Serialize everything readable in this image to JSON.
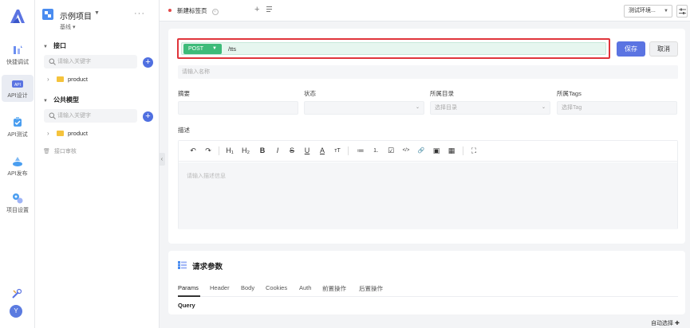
{
  "rail": {
    "items": [
      {
        "label": "快捷调试",
        "icon": "quick-debug-icon"
      },
      {
        "label": "API设计",
        "icon": "api-design-icon",
        "active": true
      },
      {
        "label": "API测试",
        "icon": "api-test-icon"
      },
      {
        "label": "API发布",
        "icon": "api-publish-icon"
      },
      {
        "label": "项目设置",
        "icon": "project-settings-icon"
      }
    ],
    "avatar_letter": "Y"
  },
  "sidebar": {
    "project_name": "示例项目",
    "branch": "基线",
    "more": "···",
    "interface_section": "接口",
    "interface_search_placeholder": "请输入关键字",
    "interface_tree": [
      {
        "label": "product"
      }
    ],
    "model_section": "公共模型",
    "model_search_placeholder": "请输入关键字",
    "model_tree": [
      {
        "label": "product"
      }
    ],
    "recycle_bin": "接口审核"
  },
  "tabs": {
    "active_tab": "新建标签页",
    "environment": "测试环境..."
  },
  "editor": {
    "method": "POST",
    "url": "/tts",
    "save_label": "保存",
    "cancel_label": "取消",
    "name_placeholder": "请输入名称",
    "summary_label": "摘要",
    "status_label": "状态",
    "directory_label": "所属目录",
    "directory_placeholder": "选择目录",
    "tags_label": "所属Tags",
    "tags_placeholder": "选择Tag",
    "description_label": "描述",
    "description_placeholder": "请输入描述信息",
    "toolbar": [
      "↶",
      "↷",
      "H₁",
      "H₂",
      "B",
      "I",
      "S",
      "U",
      "A",
      "ᴛT",
      "≔",
      "⒈",
      "☑",
      "</>",
      "🔗",
      "▣",
      "▦",
      "⛶"
    ]
  },
  "params": {
    "title": "请求参数",
    "tabs": [
      "Params",
      "Header",
      "Body",
      "Cookies",
      "Auth",
      "前置操作",
      "后置操作"
    ],
    "query_label": "Query"
  },
  "footer": {
    "auto_select": "自动选择 ✚"
  },
  "colors": {
    "accent": "#5b74e2",
    "method_post": "#3dbb79",
    "highlight_border": "#e0353b"
  }
}
